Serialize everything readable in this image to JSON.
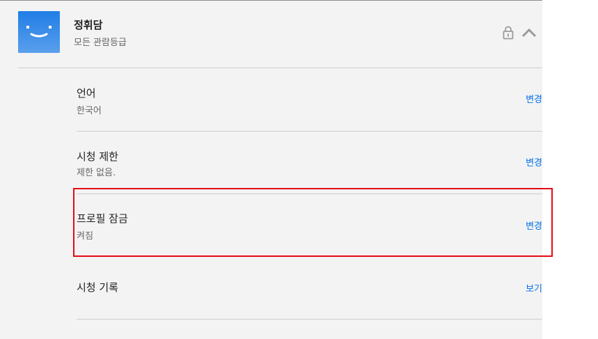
{
  "profile": {
    "name": "정휘담",
    "rating": "모든 관람등급"
  },
  "settings": [
    {
      "title": "언어",
      "value": "한국어",
      "action": "변경"
    },
    {
      "title": "시청 제한",
      "value": "제한 없음.",
      "action": "변경"
    },
    {
      "title": "프로필 잠금",
      "value": "켜짐",
      "action": "변경"
    },
    {
      "title": "시청 기록",
      "value": "",
      "action": "보기"
    }
  ],
  "icons": {
    "lock": "lock-icon",
    "collapse": "chevron-up-icon",
    "avatar": "smiley-avatar-icon"
  },
  "colors": {
    "link": "#0071eb",
    "avatar": "#2b86e8",
    "highlight": "#e50914"
  }
}
